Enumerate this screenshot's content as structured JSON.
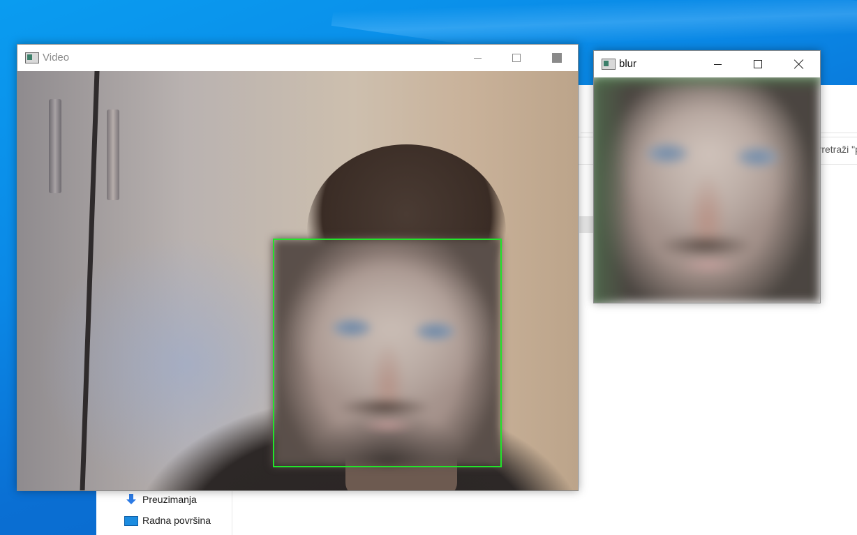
{
  "explorer": {
    "search_placeholder": "Pretraži \"pr",
    "nav_items": [
      {
        "label": "Preuzimanja",
        "icon": "download-arrow-icon"
      },
      {
        "label": "Radna površina",
        "icon": "desktop-icon"
      }
    ]
  },
  "video_window": {
    "title": "Video",
    "controls": [
      "minimize",
      "maximize",
      "close"
    ],
    "detection_color": "#22e42a"
  },
  "blur_window": {
    "title": "blur",
    "controls": [
      "minimize",
      "maximize",
      "close"
    ]
  }
}
